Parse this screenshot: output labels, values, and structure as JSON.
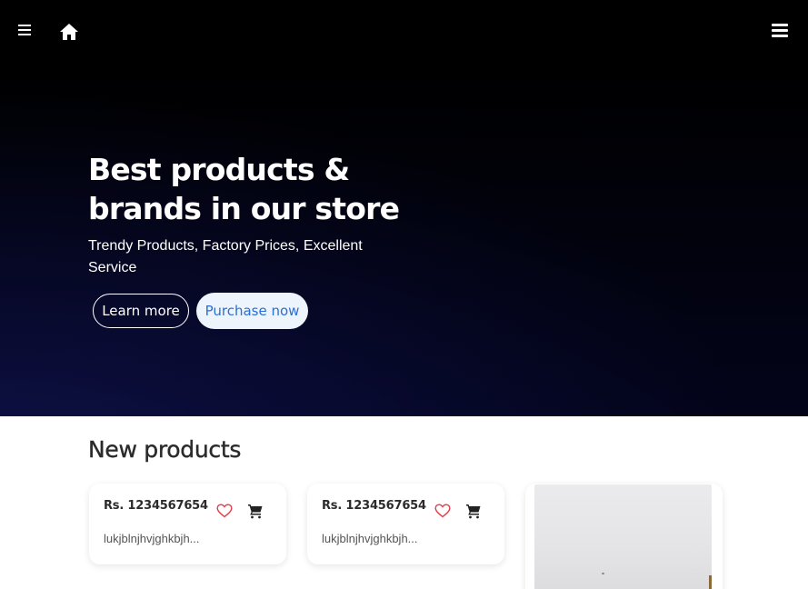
{
  "header": {
    "menu_icon": "hamburger-icon",
    "home_icon": "home-icon",
    "nav_toggle_icon": "menu-bars-icon"
  },
  "hero": {
    "title_line1": "Best products &",
    "title_line2": "brands in our store",
    "subtitle": "Trendy Products, Factory Prices, Excellent Service",
    "learn_more_label": "Learn more",
    "purchase_label": "Purchase now"
  },
  "products": {
    "section_title": "New products",
    "items": [
      {
        "price": "Rs. 1234567654",
        "description": "lukjblnjhvjghkbjh..."
      },
      {
        "price": "Rs. 1234567654",
        "description": "lukjblnjhvjghkbjh..."
      }
    ]
  },
  "colors": {
    "accent": "#2a6fd6",
    "heart": "#e53945",
    "header_bg": "#000000"
  }
}
